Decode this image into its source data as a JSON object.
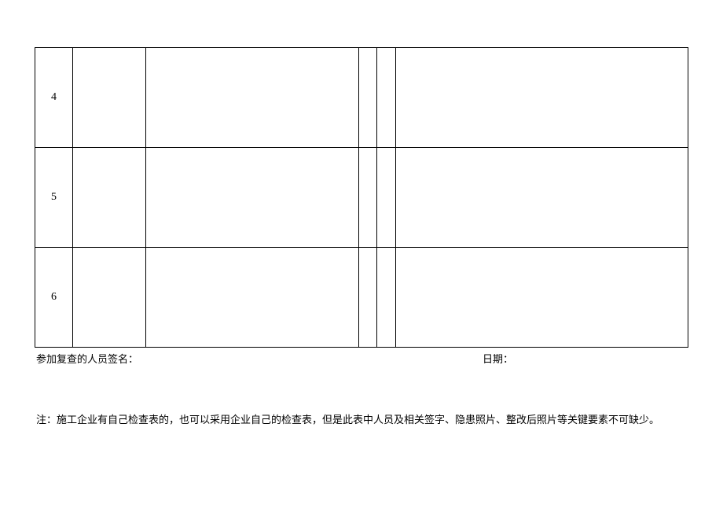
{
  "table": {
    "rows": [
      {
        "num": "4",
        "c2": "",
        "c3": "",
        "c4": "",
        "c5": "",
        "c6": ""
      },
      {
        "num": "5",
        "c2": "",
        "c3": "",
        "c4": "",
        "c5": "",
        "c6": ""
      },
      {
        "num": "6",
        "c2": "",
        "c3": "",
        "c4": "",
        "c5": "",
        "c6": ""
      }
    ]
  },
  "footer": {
    "signature_label": "参加复查的人员签名：",
    "date_label": "日期："
  },
  "note": "注：施工企业有自己检查表的，也可以采用企业自己的检查表，但是此表中人员及相关签字、隐患照片、整改后照片等关键要素不可缺少。"
}
